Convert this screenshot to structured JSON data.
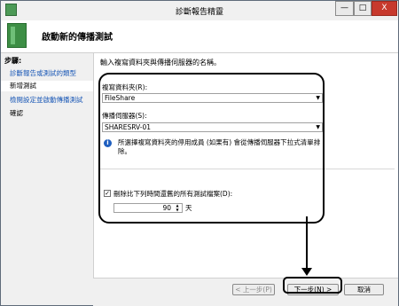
{
  "window": {
    "title": "診斷報告精靈",
    "minimize_glyph": "—",
    "maximize_glyph": "□",
    "close_glyph": "X"
  },
  "header": {
    "title": "啟動新的傳播測試"
  },
  "sidebar": {
    "steps_label": "步驟:",
    "steps": [
      {
        "label": "診斷報告或測試的類型"
      },
      {
        "label": "新增測試"
      },
      {
        "label": "檢閱設定並啟動傳播測試"
      },
      {
        "label": "確認"
      }
    ]
  },
  "main": {
    "intro": "輸入複寫資料夾與傳播伺服器的名稱。",
    "folder_label": "複寫資料夾(R):",
    "folder_value": "FileShare",
    "server_label": "傳播伺服器(S):",
    "server_value": "SHARESRV-01",
    "info_text": "所選擇複寫資料夾的停用成員 (如果有) 會從傳播伺服器下拉式清單排除。",
    "delete_checkbox_label": "刪除比下列時間還舊的所有測試檔案(D):",
    "delete_checked": true,
    "days_value": "90",
    "days_unit": "天"
  },
  "footer": {
    "back": "< 上一步(P)",
    "next": "下一步(N) >",
    "cancel": "取消"
  },
  "colors": {
    "link": "#1a58b6",
    "close_button": "#c7392d",
    "wizard_icon": "#3d8e45"
  }
}
